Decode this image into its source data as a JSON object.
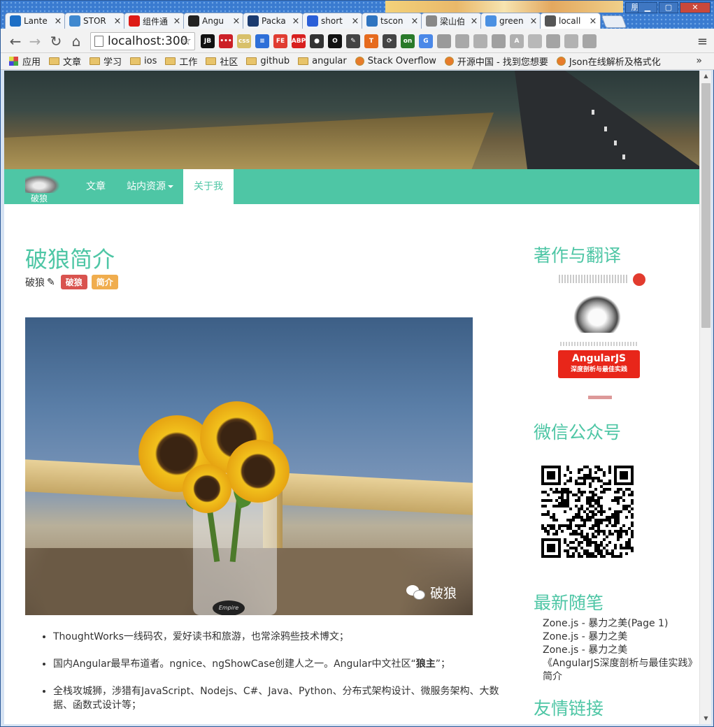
{
  "browser": {
    "tabs": [
      {
        "label": "Lante",
        "icon": "lantern-icon",
        "color": "#1d6fc6"
      },
      {
        "label": "STOR",
        "icon": "globe-icon",
        "color": "#3f88cf"
      },
      {
        "label": "组件通",
        "icon": "angular-icon",
        "color": "#dd1b16"
      },
      {
        "label": "Angu",
        "icon": "github-icon",
        "color": "#222222"
      },
      {
        "label": "Packa",
        "icon": "n-icon",
        "color": "#1b3b6f"
      },
      {
        "label": "short",
        "icon": "paw-icon",
        "color": "#2a5fd8"
      },
      {
        "label": "tscon",
        "icon": "ts-icon",
        "color": "#2f74c0"
      },
      {
        "label": "梁山伯",
        "icon": "page-icon",
        "color": "#888888"
      },
      {
        "label": "green",
        "icon": "loading-icon",
        "color": "#4a90e2"
      },
      {
        "label": "locall",
        "icon": "loading-icon",
        "color": "#555555"
      }
    ],
    "close_glyph": "×",
    "user_badge": "朋",
    "window_controls": [
      "▁",
      "▢",
      "✕"
    ],
    "nav": {
      "back": "←",
      "forward": "→",
      "reload": "↻",
      "home": "⌂"
    },
    "address": "localhost:300",
    "star": "☆",
    "extensions": [
      {
        "name": "jetbrains-icon",
        "label": "JB",
        "color": "#111111"
      },
      {
        "name": "lastpass-icon",
        "label": "•••",
        "color": "#cc2027"
      },
      {
        "name": "css-icon",
        "label": "css",
        "color": "#d8c06a"
      },
      {
        "name": "editor-icon",
        "label": "≡",
        "color": "#2e6fd8"
      },
      {
        "name": "fe-icon",
        "label": "FE",
        "color": "#e03c31"
      },
      {
        "name": "adblock-icon",
        "label": "ABP",
        "color": "#d8201f"
      },
      {
        "name": "camera-icon",
        "label": "●",
        "color": "#333333"
      },
      {
        "name": "ring-icon",
        "label": "O",
        "color": "#111111"
      },
      {
        "name": "dropper-icon",
        "label": "✎",
        "color": "#444444"
      },
      {
        "name": "t-icon",
        "label": "T",
        "color": "#e66b1e"
      },
      {
        "name": "refresh-ext-icon",
        "label": "⟳",
        "color": "#444444"
      },
      {
        "name": "on-icon",
        "label": "on",
        "color": "#2a7a2a"
      },
      {
        "name": "translate-icon",
        "label": "G",
        "color": "#4a88e8"
      },
      {
        "name": "gray-ext-1-icon",
        "label": "",
        "color": "#9a9a9a"
      },
      {
        "name": "gray-ext-2-icon",
        "label": "",
        "color": "#a8a8a8"
      },
      {
        "name": "gray-ext-3-icon",
        "label": "",
        "color": "#b0b0b0"
      },
      {
        "name": "gray-ext-4-icon",
        "label": "",
        "color": "#a0a0a0"
      },
      {
        "name": "angular-ext-icon",
        "label": "A",
        "color": "#b0b0b0"
      },
      {
        "name": "react-ext-icon",
        "label": "",
        "color": "#b8b8b8"
      },
      {
        "name": "gray-ext-5-icon",
        "label": "",
        "color": "#a4a4a4"
      },
      {
        "name": "gray-ext-6-icon",
        "label": "",
        "color": "#b2b2b2"
      },
      {
        "name": "plane-icon",
        "label": "",
        "color": "#a6a6a6"
      }
    ],
    "menu_glyph": "≡",
    "bookmarks": [
      {
        "label": "应用",
        "type": "apps"
      },
      {
        "label": "文章",
        "type": "folder"
      },
      {
        "label": "学习",
        "type": "folder"
      },
      {
        "label": "ios",
        "type": "folder"
      },
      {
        "label": "工作",
        "type": "folder"
      },
      {
        "label": "社区",
        "type": "folder"
      },
      {
        "label": "github",
        "type": "folder"
      },
      {
        "label": "angular",
        "type": "folder"
      },
      {
        "label": "Stack Overflow",
        "type": "site"
      },
      {
        "label": "开源中国 - 找到您想要",
        "type": "site"
      },
      {
        "label": "Json在线解析及格式化",
        "type": "site"
      }
    ],
    "bookmarks_more": "»"
  },
  "site": {
    "brand": "破狼",
    "nav": [
      {
        "label": "文章",
        "active": false
      },
      {
        "label": "站内资源",
        "active": false,
        "dropdown": true
      },
      {
        "label": "关于我",
        "active": true
      }
    ],
    "accent": "#4ec6a5"
  },
  "article": {
    "title": "破狼简介",
    "author": "破狼",
    "tags": [
      {
        "label": "破狼",
        "color": "#d9534f"
      },
      {
        "label": "简介",
        "color": "#f0ad4e"
      }
    ],
    "image_watermark": "破狼",
    "vase_label": "Empire",
    "bullets": [
      {
        "text": "ThoughtWorks一线码农，爱好读书和旅游，也常涂鸦些技术博文；",
        "strong": ""
      },
      {
        "text": "国内Angular最早布道者。ngnice、ngShowCase创建人之一。Angular中文社区“",
        "strong": "狼主",
        "after": "”；"
      },
      {
        "text": "全栈攻城狮，涉猎有JavaScript、Nodejs、C#、Java、Python、分布式架构设计、微服务架构、大数据、函数式设计等；",
        "strong": ""
      }
    ]
  },
  "sidebar": {
    "books_heading": "著作与翻译",
    "book": {
      "title": "AngularJS",
      "subtitle": "深度剖析与最佳实践"
    },
    "wechat_heading": "微信公众号",
    "recent_heading": "最新随笔",
    "recent": [
      "Zone.js - 暴力之美(Page 1)",
      "Zone.js - 暴力之美",
      "Zone.js - 暴力之美",
      "《AngularJS深度剖析与最佳实践》简介"
    ],
    "links_heading": "友情链接"
  }
}
